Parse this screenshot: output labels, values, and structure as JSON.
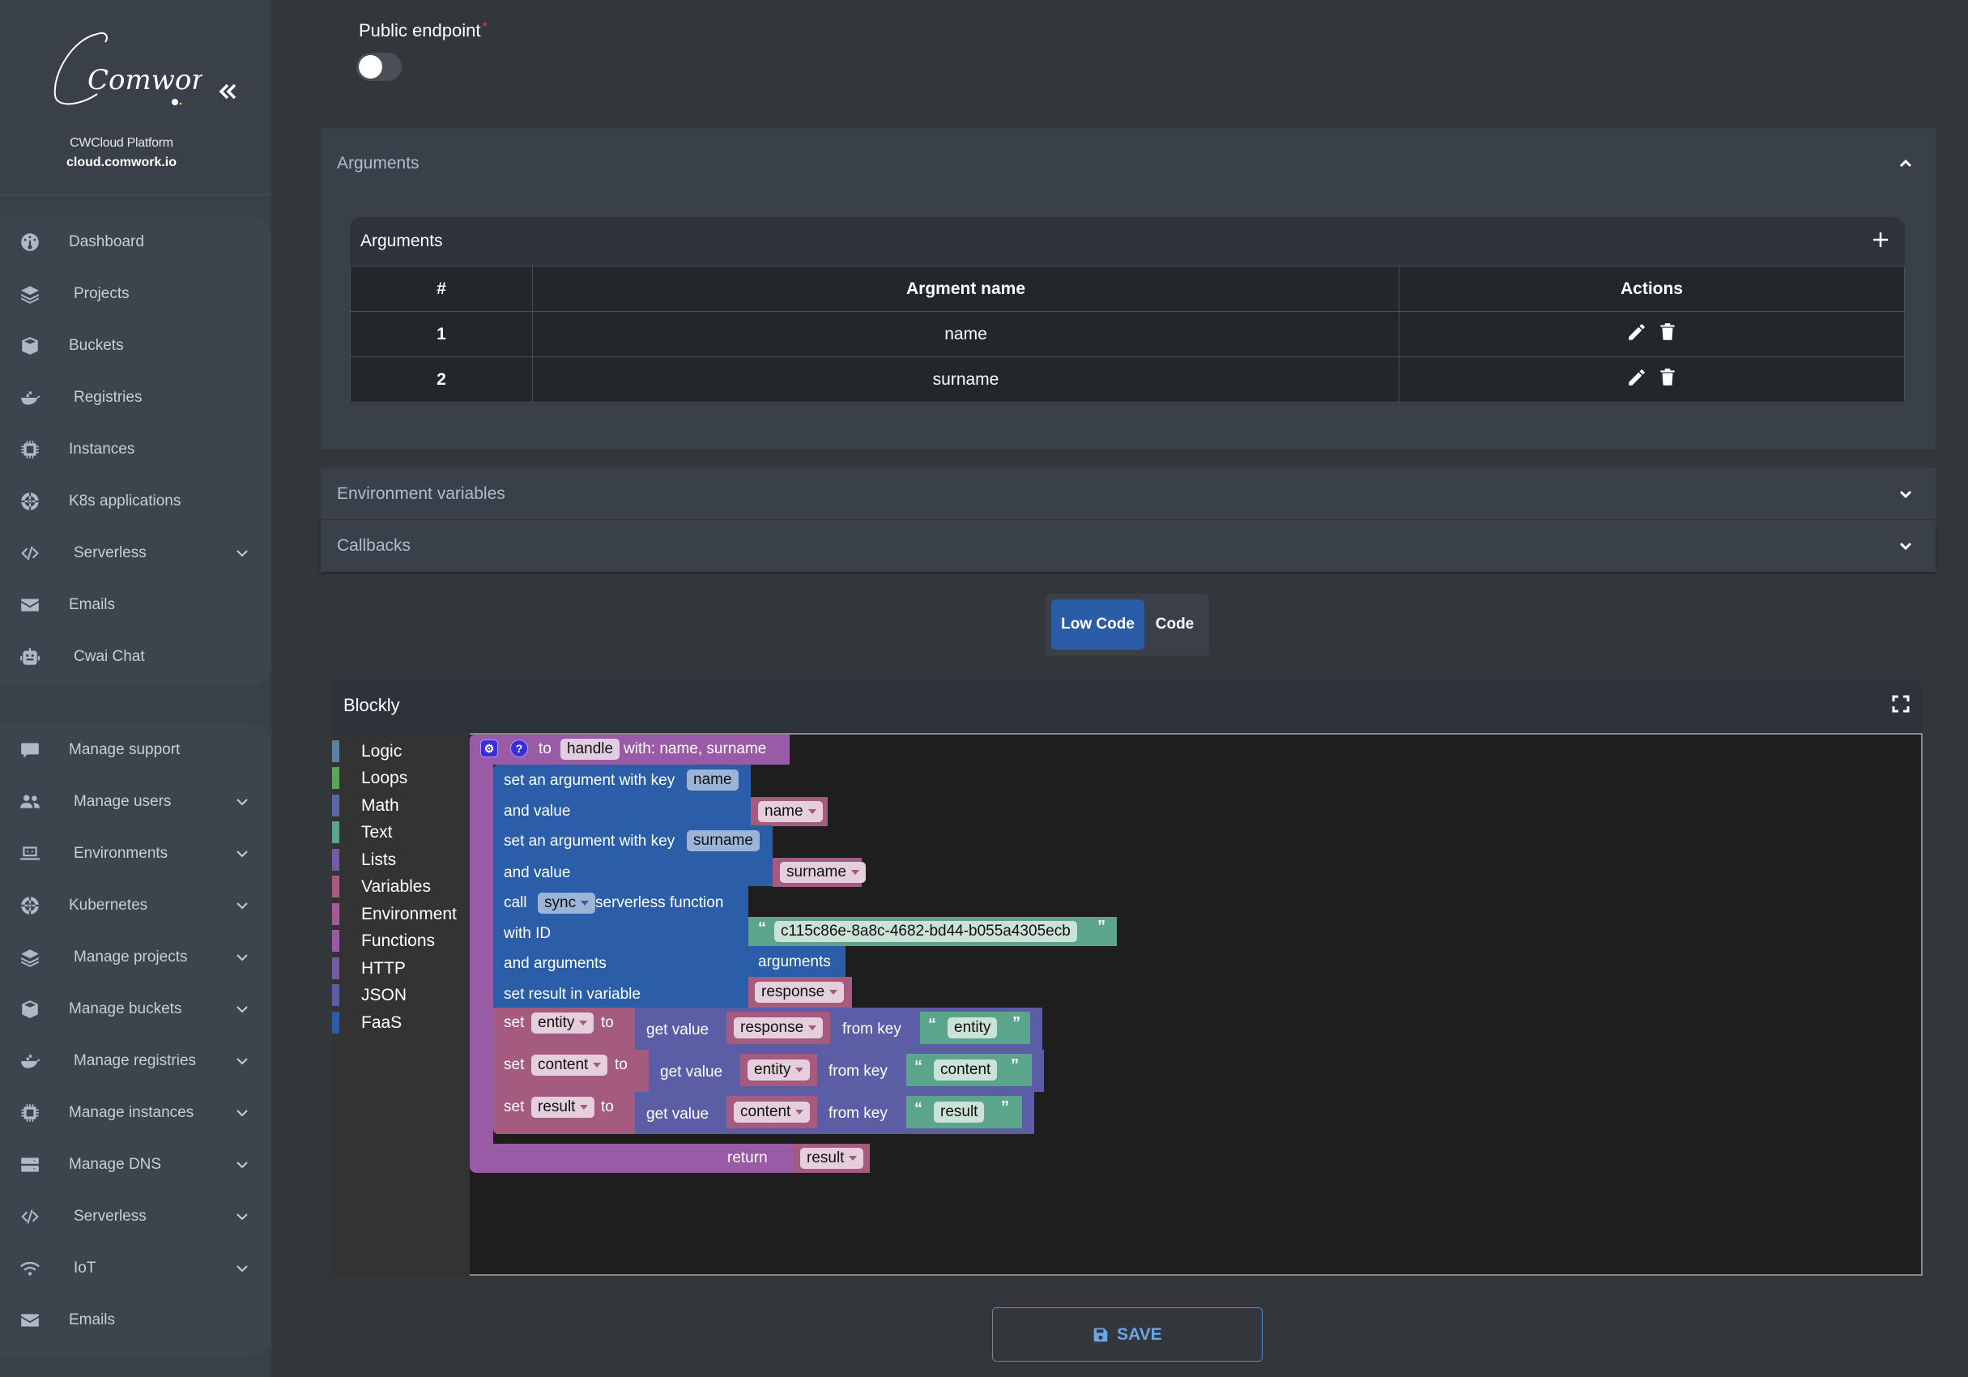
{
  "brand": {
    "logo_text": "Comwork",
    "platform": "CWCloud Platform",
    "url": "cloud.comwork.io",
    "collapse_icon": "double-chevron-left-icon"
  },
  "sidebar": {
    "group1": [
      {
        "label": "Dashboard",
        "icon": "dashboard-gauge-icon",
        "chevron": false
      },
      {
        "label": "Projects",
        "icon": "layers-icon",
        "chevron": false
      },
      {
        "label": "Buckets",
        "icon": "cube-icon",
        "chevron": false
      },
      {
        "label": "Registries",
        "icon": "docker-whale-icon",
        "chevron": false
      },
      {
        "label": "Instances",
        "icon": "cpu-chip-icon",
        "chevron": false
      },
      {
        "label": "K8s applications",
        "icon": "helm-wheel-icon",
        "chevron": false
      },
      {
        "label": "Serverless",
        "icon": "code-icon",
        "chevron": true
      },
      {
        "label": "Emails",
        "icon": "envelope-icon",
        "chevron": false
      },
      {
        "label": "Cwai Chat",
        "icon": "robot-icon",
        "chevron": false
      }
    ],
    "group2": [
      {
        "label": "Manage support",
        "icon": "chat-bubble-icon",
        "chevron": false
      },
      {
        "label": "Manage users",
        "icon": "users-icon",
        "chevron": true
      },
      {
        "label": "Environments",
        "icon": "laptop-code-icon",
        "chevron": true
      },
      {
        "label": "Kubernetes",
        "icon": "helm-wheel-icon",
        "chevron": true
      },
      {
        "label": "Manage projects",
        "icon": "layers-icon",
        "chevron": true
      },
      {
        "label": "Manage buckets",
        "icon": "cube-icon",
        "chevron": true
      },
      {
        "label": "Manage registries",
        "icon": "docker-whale-icon",
        "chevron": true
      },
      {
        "label": "Manage instances",
        "icon": "cpu-chip-icon",
        "chevron": true
      },
      {
        "label": "Manage DNS",
        "icon": "server-icon",
        "chevron": true
      },
      {
        "label": "Serverless",
        "icon": "code-icon",
        "chevron": true
      },
      {
        "label": "IoT",
        "icon": "wifi-icon",
        "chevron": true
      },
      {
        "label": "Emails",
        "icon": "envelope-icon",
        "chevron": false
      }
    ]
  },
  "form": {
    "public_endpoint_label": "Public endpoint",
    "required_mark": "*",
    "public_endpoint_on": false
  },
  "arguments_section": {
    "title": "Arguments",
    "expanded": true,
    "card_title": "Arguments",
    "columns": [
      "#",
      "Argment name",
      "Actions"
    ],
    "rows": [
      {
        "index": "1",
        "name": "name"
      },
      {
        "index": "2",
        "name": "surname"
      }
    ]
  },
  "env_section": {
    "title": "Environment variables",
    "expanded": false
  },
  "callbacks_section": {
    "title": "Callbacks",
    "expanded": false
  },
  "mode_switch": {
    "options": [
      "Low Code",
      "Code"
    ],
    "selected": "Low Code"
  },
  "blockly": {
    "title": "Blockly",
    "toolbox": [
      {
        "label": "Logic",
        "color": "#5b80a5"
      },
      {
        "label": "Loops",
        "color": "#5ba55b"
      },
      {
        "label": "Math",
        "color": "#5b67a5"
      },
      {
        "label": "Text",
        "color": "#5ba58c"
      },
      {
        "label": "Lists",
        "color": "#745ba5"
      },
      {
        "label": "Variables",
        "color": "#a55b80"
      },
      {
        "label": "Environment",
        "color": "#a55b99"
      },
      {
        "label": "Functions",
        "color": "#995ba5"
      },
      {
        "label": "HTTP",
        "color": "#745ba5"
      },
      {
        "label": "JSON",
        "color": "#5b5ea5"
      },
      {
        "label": "FaaS",
        "color": "#2b5ea8"
      }
    ],
    "blocks": {
      "fn_to": "to",
      "fn_name": "handle",
      "fn_with": "with: name, surname",
      "set_arg_label": "set an argument with key",
      "and_value": "and value",
      "arg1_key": "name",
      "arg1_val": "name",
      "arg2_key": "surname",
      "arg2_val": "surname",
      "call": "call",
      "call_mode": "sync",
      "serverless_function": "serverless function",
      "with_id": "with ID",
      "function_id": "c115c86e-8a8c-4682-bd44-b055a4305ecb",
      "and_arguments": "and arguments",
      "arguments_var": "arguments",
      "set_result_in": "set result in variable",
      "response_var": "response",
      "set": "set",
      "to": "to",
      "get_value": "get value",
      "from_key": "from key",
      "assign": [
        {
          "var": "entity",
          "source": "response",
          "key": "entity"
        },
        {
          "var": "content",
          "source": "entity",
          "key": "content"
        },
        {
          "var": "result",
          "source": "content",
          "key": "result"
        }
      ],
      "return": "return",
      "return_var": "result",
      "open_quote": "“",
      "close_quote": "”"
    }
  },
  "save_button": {
    "label": "SAVE",
    "icon": "floppy-disk-icon"
  },
  "colors": {
    "accent_blue": "#2a5ca8",
    "save_blue": "#6aa6e8",
    "required_red": "#e23b3b"
  }
}
